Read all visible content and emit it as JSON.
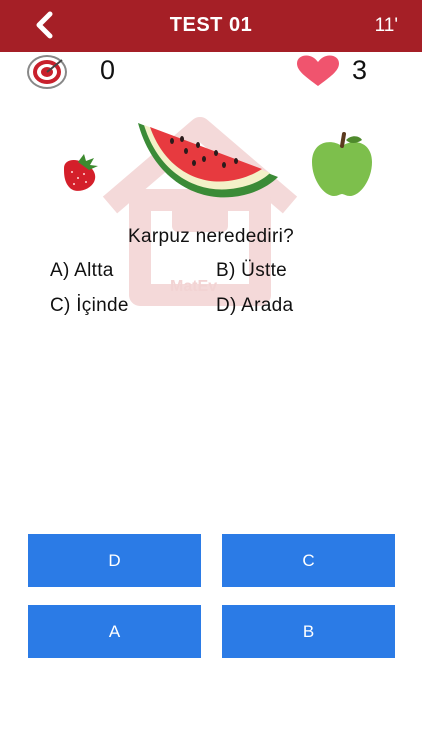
{
  "header": {
    "back_icon": "chevron-left-icon",
    "title": "TEST 01",
    "timer": "11'"
  },
  "stats": {
    "target_icon": "target-icon",
    "score": "0",
    "heart_icon": "heart-icon",
    "lives": "3"
  },
  "illustration": {
    "items": [
      "strawberry",
      "watermelon-slice",
      "green-apple"
    ],
    "watermark": "MatEv"
  },
  "question": {
    "text": "Karpuz neredediri?",
    "options": {
      "a": "A)  Altta",
      "b": "B)  Üstte",
      "c": "C)  İçinde",
      "d": "D)  Arada"
    }
  },
  "answers": [
    "D",
    "C",
    "A",
    "B"
  ],
  "colors": {
    "header_bg": "#a51f26",
    "button_bg": "#2b7be6",
    "heart": "#f0546e"
  }
}
